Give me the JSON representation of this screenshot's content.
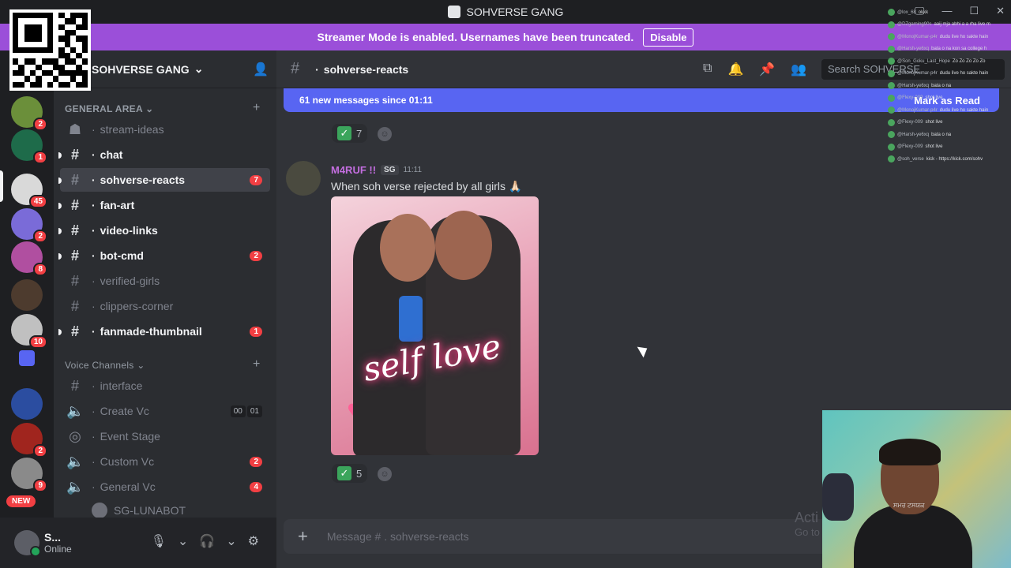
{
  "window": {
    "title": "SOHVERSE GANG",
    "controls": [
      "🖵",
      "—",
      "☐",
      "✕"
    ]
  },
  "banner": {
    "text": "Streamer Mode is enabled. Usernames have been truncated.",
    "button": "Disable"
  },
  "servers": [
    {
      "badge": "2",
      "color": "#6b8f3a"
    },
    {
      "badge": "1",
      "color": "#1e6b4a"
    },
    {
      "badge": "45",
      "color": "#d9d9d9"
    },
    {
      "badge": "2",
      "color": "#7a6bd8"
    },
    {
      "badge": "8",
      "color": "#b04fa0"
    },
    {
      "badge": "",
      "color": "#4d3b2e"
    },
    {
      "badge": "10",
      "color": "#c0c0c0"
    },
    {
      "badge": "",
      "color": "#5865f2"
    },
    {
      "badge": "",
      "color": "#2b4da0"
    },
    {
      "badge": "2",
      "color": "#a0251e"
    },
    {
      "badge": "9",
      "color": "#8a8a8a"
    }
  ],
  "new_label": "NEW",
  "guild": {
    "name": "SOHVERSE GANG",
    "chevron": "⌄"
  },
  "categories": {
    "general": "GENERAL AREA",
    "voice": "Voice Channels"
  },
  "channels": [
    {
      "name": "stream-ideas",
      "icon": "☗",
      "count": ""
    },
    {
      "name": "chat",
      "icon": "#",
      "count": ""
    },
    {
      "name": "sohverse-reacts",
      "icon": "#",
      "count": "7"
    },
    {
      "name": "fan-art",
      "icon": "#",
      "count": ""
    },
    {
      "name": "video-links",
      "icon": "#",
      "count": ""
    },
    {
      "name": "bot-cmd",
      "icon": "#",
      "count": "2"
    },
    {
      "name": "verified-girls",
      "icon": "#",
      "count": ""
    },
    {
      "name": "clippers-corner",
      "icon": "#",
      "count": ""
    },
    {
      "name": "fanmade-thumbnail",
      "icon": "#",
      "count": "1"
    }
  ],
  "voice_channels": [
    {
      "name": "interface",
      "icon": "#",
      "count": ""
    },
    {
      "name": "Create Vc",
      "icon": "🔈",
      "count": ""
    },
    {
      "name": "Event Stage",
      "icon": "◎",
      "count": ""
    },
    {
      "name": "Custom Vc",
      "icon": "🔈",
      "count": "2"
    },
    {
      "name": "General Vc",
      "icon": "🔈",
      "count": "4"
    }
  ],
  "vc_counter": [
    "00",
    "01"
  ],
  "voice_user": "SG-LUNABOT",
  "user": {
    "name": "S...",
    "status": "Online"
  },
  "current_channel": "sohverse-reacts",
  "search": {
    "placeholder": "Search SOHVERSE"
  },
  "new_messages": {
    "text": "61 new messages since 01:11",
    "mark": "Mark as Read"
  },
  "reaction_top": {
    "emoji": "✓",
    "count": "7"
  },
  "message": {
    "author": "M4RUF !!",
    "tag": "SG",
    "time": "11:11",
    "text": "When soh verse rejected by all girls 🙏🏻",
    "image_caption": "self love"
  },
  "reaction_bottom": {
    "emoji": "✓",
    "count": "5"
  },
  "composer": {
    "placeholder": "Message # . sohverse-reacts"
  },
  "watermark": {
    "line1": "Acti",
    "line2": "Go to"
  },
  "overlay_chat": [
    {
      "user": "@lox_68",
      "text": "okkk"
    },
    {
      "user": "@DZgaming90s",
      "text": "aaij mja abhi a a rha live m"
    },
    {
      "user": "@MonojKumar-p4r",
      "text": "dudu live ho sakte hain"
    },
    {
      "user": "@Harsh-ye6xq",
      "text": "bata o na kon sa college h"
    },
    {
      "user": "@Son_Goku_Last_Hope",
      "text": "Zo Zo Zo Zo Zo"
    },
    {
      "user": "@MonojKumar-p4r",
      "text": "dudu live ho sakte hain"
    },
    {
      "user": "@Harsh-ye6xq",
      "text": "bata o na"
    },
    {
      "user": "@Flexy-009",
      "text": "shot live"
    },
    {
      "user": "@MonojKumar-p4r",
      "text": "dudu live ho sakte hain"
    },
    {
      "user": "@Flexy-009",
      "text": "shot live"
    },
    {
      "user": "@Harsh-ye6xq",
      "text": "bata o na"
    },
    {
      "user": "@Flexy-009",
      "text": "shot live"
    },
    {
      "user": "@soh_verse",
      "text": "kick - https://kick.com/sohv"
    }
  ],
  "webcam": {
    "shirt_text": "ਸਮਰ ਟਸਯਕ"
  }
}
